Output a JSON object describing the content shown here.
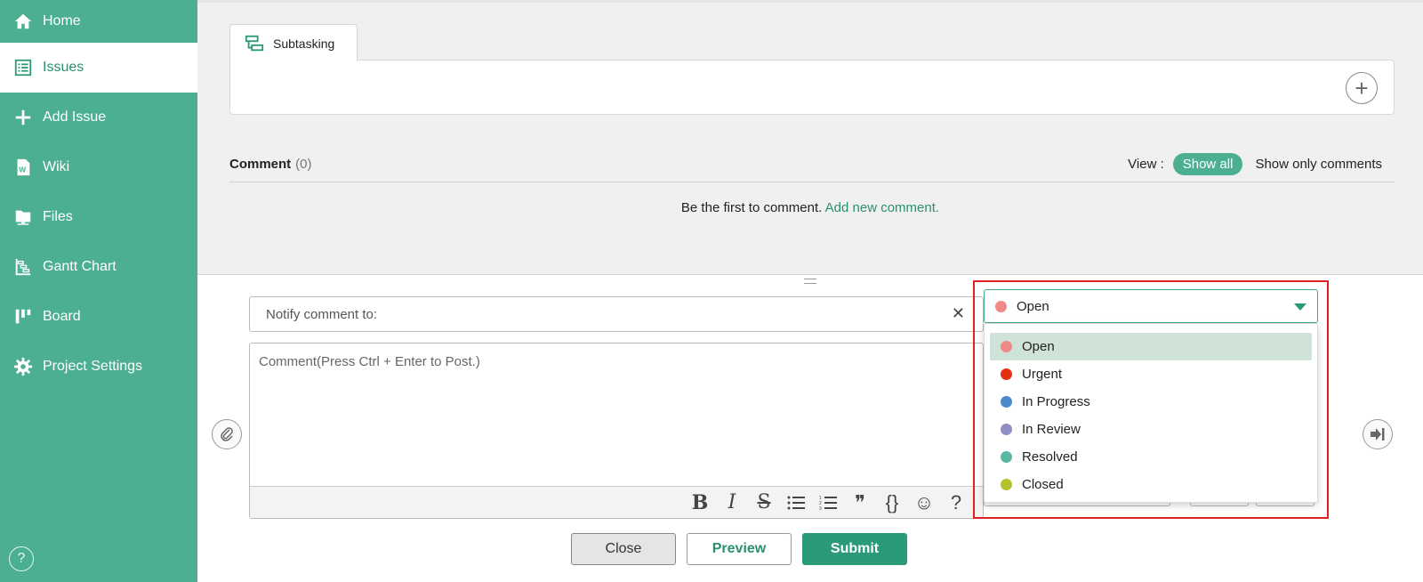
{
  "sidebar": {
    "items": [
      {
        "label": "Home",
        "icon": "home-icon"
      },
      {
        "label": "Issues",
        "icon": "list-icon"
      },
      {
        "label": "Add Issue",
        "icon": "plus-icon"
      },
      {
        "label": "Wiki",
        "icon": "wiki-icon"
      },
      {
        "label": "Files",
        "icon": "folder-icon"
      },
      {
        "label": "Gantt Chart",
        "icon": "gantt-icon"
      },
      {
        "label": "Board",
        "icon": "board-icon"
      },
      {
        "label": "Project Settings",
        "icon": "gear-icon"
      }
    ],
    "active": "Issues",
    "help": "?"
  },
  "subtasking": {
    "tab_label": "Subtasking",
    "add_symbol": "+"
  },
  "comments": {
    "title": "Comment",
    "count": "(0)",
    "view_label": "View :",
    "show_all": "Show all",
    "show_only": "Show only comments",
    "empty_text": "Be the first to comment.",
    "add_link": "Add new comment."
  },
  "editor": {
    "notify_label": "Notify comment to:",
    "notify_clear": "✕",
    "placeholder": "Comment(Press Ctrl + Enter to Post.)",
    "toolbar": {
      "bold": "B",
      "italic": "I",
      "strike": "S",
      "bullet_list": "bulleted-list-icon",
      "numbered_list": "numbered-list-icon",
      "quote": "❞",
      "code": "{}",
      "emoji": "☺",
      "help": "?"
    }
  },
  "status": {
    "selected": "Open",
    "selected_color": "#ef8a87",
    "options": [
      {
        "label": "Open",
        "color": "#ef8a87"
      },
      {
        "label": "Urgent",
        "color": "#e53012"
      },
      {
        "label": "In Progress",
        "color": "#4a8bd0"
      },
      {
        "label": "In Review",
        "color": "#8f8fc5"
      },
      {
        "label": "Resolved",
        "color": "#5ab8a2"
      },
      {
        "label": "Closed",
        "color": "#b5c22d"
      }
    ]
  },
  "actions": {
    "close": "Close",
    "preview": "Preview",
    "submit": "Submit"
  },
  "colors": {
    "sidebar": "#4caf91",
    "accent": "#2b9a78",
    "highlight_border": "#e02020"
  }
}
